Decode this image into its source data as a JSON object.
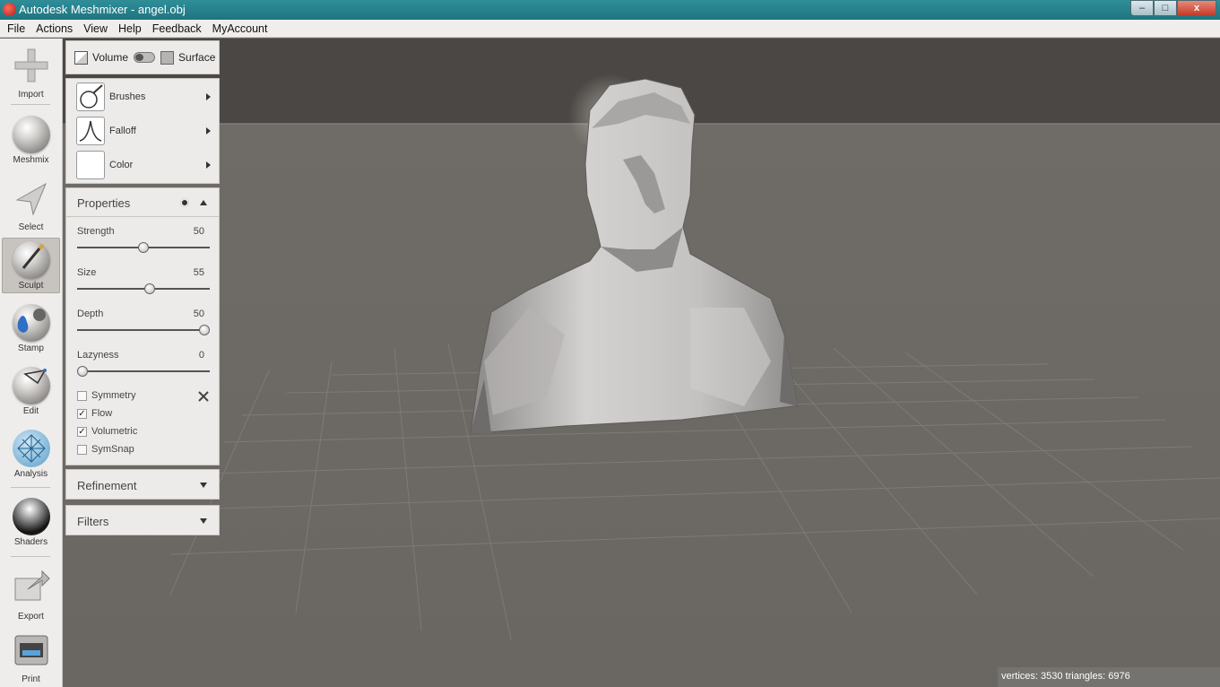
{
  "window": {
    "title": "Autodesk Meshmixer - angel.obj",
    "minimize": "–",
    "maximize": "□",
    "close": "x"
  },
  "menu": [
    "File",
    "Actions",
    "View",
    "Help",
    "Feedback",
    "MyAccount"
  ],
  "toolbar": {
    "tools": [
      {
        "label": "Import",
        "icon": "plus-icon"
      },
      {
        "label": "Meshmix",
        "icon": "meshmix-sphere-icon"
      },
      {
        "label": "Select",
        "icon": "arrow-cursor-icon"
      },
      {
        "label": "Sculpt",
        "icon": "brush-sphere-icon",
        "active": true
      },
      {
        "label": "Stamp",
        "icon": "stamp-icon"
      },
      {
        "label": "Edit",
        "icon": "edit-sphere-icon"
      },
      {
        "label": "Analysis",
        "icon": "analysis-mesh-icon"
      },
      {
        "label": "Shaders",
        "icon": "shader-sphere-icon"
      },
      {
        "label": "Export",
        "icon": "export-icon"
      },
      {
        "label": "Print",
        "icon": "printer-icon"
      }
    ]
  },
  "mode_panel": {
    "volume_label": "Volume",
    "surface_label": "Surface"
  },
  "brush_panel": {
    "brushes_label": "Brushes",
    "falloff_label": "Falloff",
    "color_label": "Color"
  },
  "properties": {
    "title": "Properties",
    "sliders": [
      {
        "label": "Strength",
        "value": "50",
        "fraction": 0.5
      },
      {
        "label": "Size",
        "value": "55",
        "fraction": 0.55
      },
      {
        "label": "Depth",
        "value": "50",
        "fraction": 1.0
      },
      {
        "label": "Lazyness",
        "value": "0",
        "fraction": 0.0
      }
    ],
    "checkboxes": [
      {
        "label": "Symmetry",
        "checked": false
      },
      {
        "label": "Flow",
        "checked": true
      },
      {
        "label": "Volumetric",
        "checked": true
      },
      {
        "label": "SymSnap",
        "checked": false
      }
    ]
  },
  "refinement": {
    "title": "Refinement"
  },
  "filters": {
    "title": "Filters"
  },
  "status": {
    "text": "vertices: 3530 triangles: 6976"
  },
  "colors": {
    "titlebar": "#1e7580",
    "viewport_bg": "#6b6763",
    "panel_bg": "#edebe9"
  }
}
